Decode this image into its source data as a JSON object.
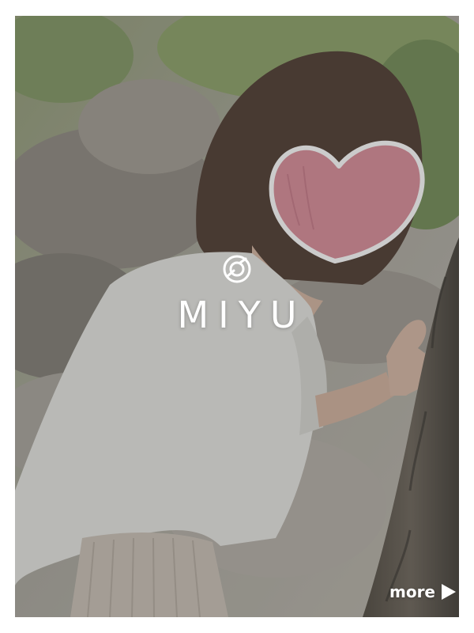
{
  "profile": {
    "name": "MIYU",
    "logo_icon": "camera-lens-icon",
    "more_label": "more",
    "more_icon": "play-arrow-icon"
  },
  "colors": {
    "overlay": "#464646",
    "text": "#ffffff",
    "heart": "#d88a96",
    "heart_outline": "#ffffff"
  }
}
